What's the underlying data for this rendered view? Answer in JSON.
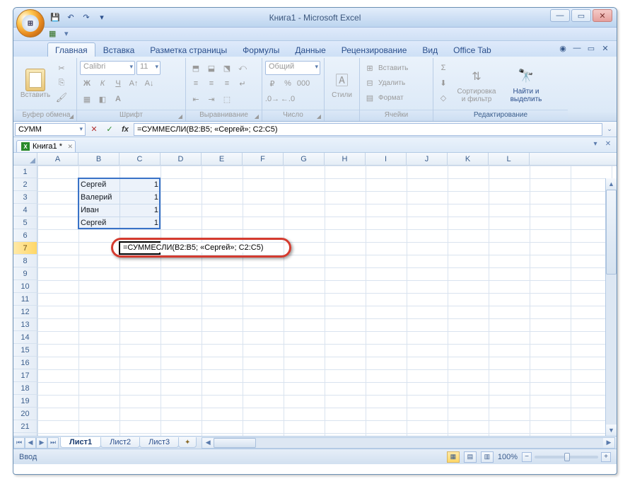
{
  "title": {
    "doc": "Книга1",
    "app": "Microsoft Excel"
  },
  "tabs": [
    "Главная",
    "Вставка",
    "Разметка страницы",
    "Формулы",
    "Данные",
    "Рецензирование",
    "Вид",
    "Office Tab"
  ],
  "active_tab": 0,
  "ribbon": {
    "clipboard": {
      "paste": "Вставить",
      "label": "Буфер обмена"
    },
    "font": {
      "name": "Calibri",
      "size": "11",
      "label": "Шрифт"
    },
    "alignment": {
      "label": "Выравнивание"
    },
    "number": {
      "format": "Общий",
      "label": "Число"
    },
    "styles": {
      "btn": "Стили"
    },
    "cells": {
      "insert": "Вставить",
      "delete": "Удалить",
      "format": "Формат",
      "label": "Ячейки"
    },
    "editing": {
      "sort": "Сортировка и фильтр",
      "find": "Найти и выделить",
      "label": "Редактирование"
    }
  },
  "formula_bar": {
    "name_box": "СУММ",
    "formula": "=СУММЕСЛИ(B2:B5; «Сергей»; C2:C5)"
  },
  "workbook_tab": "Книга1 *",
  "columns": [
    "A",
    "B",
    "C",
    "D",
    "E",
    "F",
    "G",
    "H",
    "I",
    "J",
    "K",
    "L"
  ],
  "rows": 24,
  "active_row": 7,
  "selection": {
    "range": "B2:C5"
  },
  "data": {
    "B2": "Сергей",
    "C2": "1",
    "B3": "Валерий",
    "C3": "1",
    "B4": "Иван",
    "C4": "1",
    "B5": "Сергей",
    "C5": "1"
  },
  "active_cell": "C7",
  "cell_formula_display": "=СУММЕСЛИ(B2:B5; «Сергей»; C2:C5)",
  "sheets": [
    "Лист1",
    "Лист2",
    "Лист3"
  ],
  "active_sheet": 0,
  "status": {
    "mode": "Ввод",
    "zoom": "100%"
  }
}
